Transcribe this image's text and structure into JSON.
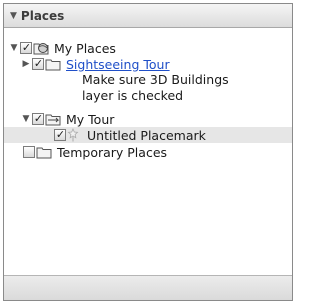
{
  "panel": {
    "title": "Places",
    "items": [
      {
        "label": "My Places",
        "checked": true,
        "expanded": true,
        "icon": "places-globe-icon"
      },
      {
        "label": "Sightseeing Tour",
        "checked": true,
        "expanded": false,
        "icon": "folder-icon",
        "description": [
          "Make sure 3D Buildings",
          "layer is checked"
        ]
      },
      {
        "label": "My Tour",
        "checked": true,
        "expanded": true,
        "icon": "tour-icon"
      },
      {
        "label": "Untitled Placemark",
        "checked": true,
        "icon": "placemark-pin-icon",
        "selected": true
      },
      {
        "label": "Temporary Places",
        "checked": false,
        "icon": "folder-icon"
      }
    ]
  }
}
